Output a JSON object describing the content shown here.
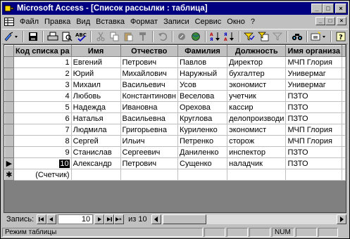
{
  "window": {
    "title": "Microsoft Access - [Список рассылки : таблица]",
    "minimize": "_",
    "maximize": "□",
    "close": "×"
  },
  "menu": {
    "items": [
      {
        "label": "Файл"
      },
      {
        "label": "Правка"
      },
      {
        "label": "Вид"
      },
      {
        "label": "Вставка"
      },
      {
        "label": "Формат"
      },
      {
        "label": "Записи"
      },
      {
        "label": "Сервис"
      },
      {
        "label": "Окно"
      },
      {
        "label": "?"
      }
    ]
  },
  "table": {
    "columns": [
      "Код списка ра",
      "Имя",
      "Отчество",
      "Фамилия",
      "Должность",
      "Имя организа"
    ],
    "rows": [
      {
        "id": "1",
        "first": "Евгений",
        "middle": "Петрович",
        "last": "Павлов",
        "position": "Директор",
        "org": "МЧП Глория"
      },
      {
        "id": "2",
        "first": "Юрий",
        "middle": "Михайлович",
        "last": "Наружный",
        "position": "бухгалтер",
        "org": "Универмаг"
      },
      {
        "id": "3",
        "first": "Михаил",
        "middle": "Васильевич",
        "last": "Усов",
        "position": "экономист",
        "org": "Универмаг"
      },
      {
        "id": "4",
        "first": "Любовь",
        "middle": "Константиновн",
        "last": "Веселова",
        "position": "учетчик",
        "org": "ПЗТО"
      },
      {
        "id": "5",
        "first": "Надежда",
        "middle": "Ивановна",
        "last": "Орехова",
        "position": "кассир",
        "org": "ПЗТО"
      },
      {
        "id": "6",
        "first": "Наталья",
        "middle": "Васильевна",
        "last": "Круглова",
        "position": "делопроизводи",
        "org": "ПЗТО"
      },
      {
        "id": "7",
        "first": "Людмила",
        "middle": "Григорьевна",
        "last": "Куриленко",
        "position": "экономист",
        "org": "МЧП Глория"
      },
      {
        "id": "8",
        "first": "Сергей",
        "middle": "Ильич",
        "last": "Петренко",
        "position": "сторож",
        "org": "МЧП Глория"
      },
      {
        "id": "9",
        "first": "Станислав",
        "middle": "Сергеевич",
        "last": "Даниленко",
        "position": "инспектор",
        "org": "ПЗТО"
      },
      {
        "id": "10",
        "first": "Александр",
        "middle": "Петрович",
        "last": "Сущенко",
        "position": "наладчик",
        "org": "ПЗТО"
      }
    ],
    "new_row_counter": "(Счетчик)",
    "current_row_marker": "▶",
    "new_row_marker": "✱"
  },
  "navigation": {
    "label": "Запись:",
    "current": "10",
    "of_text": "из 10"
  },
  "status": {
    "mode": "Режим таблицы",
    "num": "NUM"
  },
  "colors": {
    "titlebar": "#000080",
    "chrome": "#c0c0c0",
    "workspace": "#808080"
  }
}
